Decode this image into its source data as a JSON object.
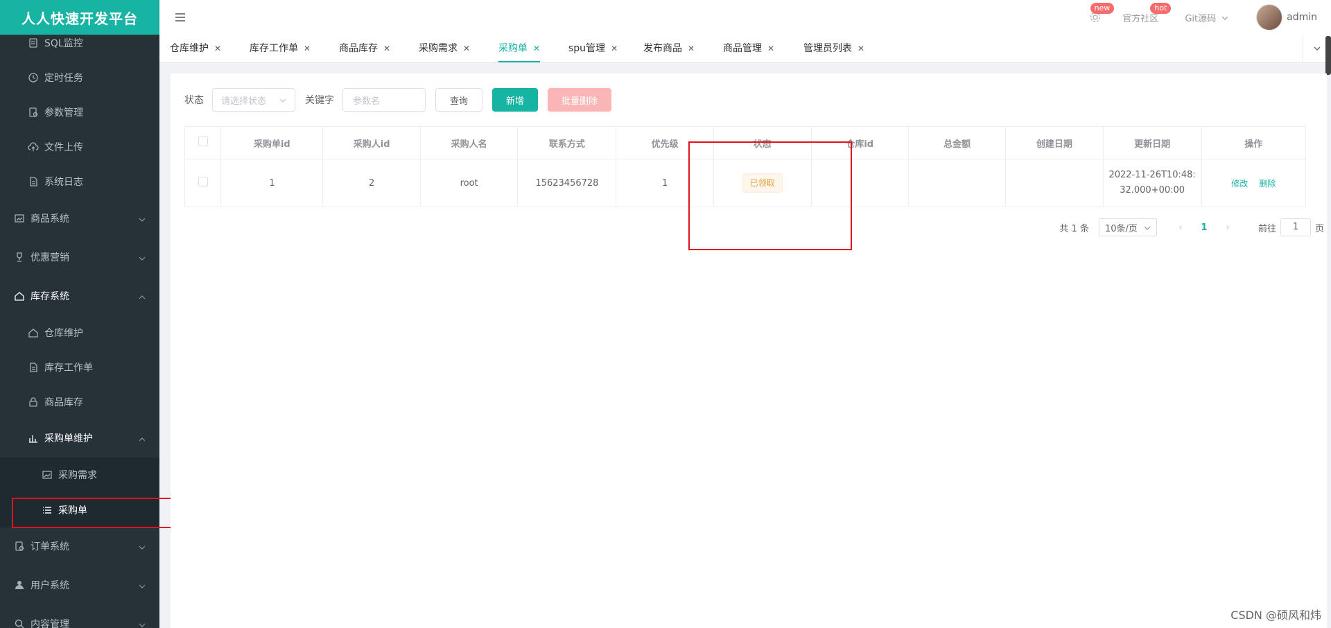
{
  "brand": "人人快速开发平台",
  "sidebar": {
    "items": [
      {
        "label": "SQL监控",
        "icon": "db-icon"
      },
      {
        "label": "定时任务",
        "icon": "clock-icon"
      },
      {
        "label": "参数管理",
        "icon": "config-icon"
      },
      {
        "label": "文件上传",
        "icon": "cloud-upload-icon"
      },
      {
        "label": "系统日志",
        "icon": "doc-icon"
      },
      {
        "label": "商品系统",
        "icon": "image-icon"
      },
      {
        "label": "优惠营销",
        "icon": "trophy-icon"
      },
      {
        "label": "库存系统",
        "icon": "home-icon"
      },
      {
        "label": "仓库维护",
        "icon": "home-icon"
      },
      {
        "label": "库存工作单",
        "icon": "doc-icon"
      },
      {
        "label": "商品库存",
        "icon": "lock-icon"
      },
      {
        "label": "采购单维护",
        "icon": "chart-icon"
      },
      {
        "label": "采购需求",
        "icon": "image-icon"
      },
      {
        "label": "采购单",
        "icon": "list-icon"
      },
      {
        "label": "订单系统",
        "icon": "config-icon"
      },
      {
        "label": "用户系统",
        "icon": "user-icon"
      },
      {
        "label": "内容管理",
        "icon": "search-icon"
      }
    ]
  },
  "topbar": {
    "community": "官方社区",
    "git": "Git源码",
    "badge_new": "new",
    "badge_hot": "hot",
    "user": "admin"
  },
  "tabs": [
    {
      "label": "仓库维护"
    },
    {
      "label": "库存工作单"
    },
    {
      "label": "商品库存"
    },
    {
      "label": "采购需求"
    },
    {
      "label": "采购单",
      "active": true
    },
    {
      "label": "spu管理"
    },
    {
      "label": "发布商品"
    },
    {
      "label": "商品管理"
    },
    {
      "label": "管理员列表"
    }
  ],
  "filter": {
    "status_label": "状态",
    "status_placeholder": "请选择状态",
    "keyword_label": "关键字",
    "keyword_placeholder": "参数名",
    "query": "查询",
    "add": "新增",
    "batch_delete": "批量删除"
  },
  "table": {
    "headers": [
      "采购单id",
      "采购人id",
      "采购人名",
      "联系方式",
      "优先级",
      "状态",
      "仓库id",
      "总金额",
      "创建日期",
      "更新日期",
      "操作"
    ],
    "rows": [
      {
        "id": "1",
        "buyer_id": "2",
        "buyer_name": "root",
        "phone": "15623456728",
        "priority": "1",
        "status": "已领取",
        "warehouse_id": "",
        "amount": "",
        "created": "",
        "updated_line1": "2022-11-26T10:48:",
        "updated_line2": "32.000+00:00",
        "edit": "修改",
        "delete": "删除"
      }
    ]
  },
  "pager": {
    "total": "共 1 条",
    "size": "10条/页",
    "current": "1",
    "goto_prefix": "前往",
    "goto_value": "1",
    "goto_suffix": "页"
  },
  "watermark": "CSDN @硕风和炜"
}
